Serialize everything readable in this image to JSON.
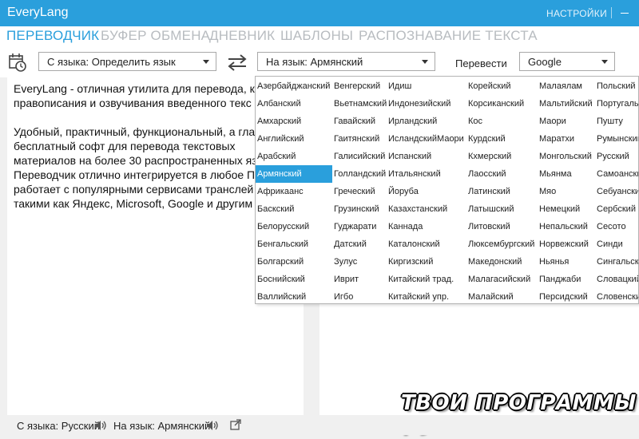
{
  "app": {
    "title": "EveryLang",
    "settings_label": "НАСТРОЙКИ"
  },
  "tabs": [
    {
      "label": "ПЕРЕВОДЧИК",
      "active": true
    },
    {
      "label": "БУФЕР ОБМЕНА",
      "active": false
    },
    {
      "label": "ДНЕВНИК",
      "active": false
    },
    {
      "label": "ШАБЛОНЫ",
      "active": false
    },
    {
      "label": "РАСПОЗНАВАНИЕ ТЕКСТА",
      "active": false
    }
  ],
  "toolbar": {
    "history_icon": "history-calendar-icon",
    "from_select": "С языка: Определить язык",
    "swap_icon": "swap-arrows-icon",
    "to_select": "На язык: Армянский",
    "translate_label": "Перевести",
    "service_select": "Google"
  },
  "source": {
    "paragraph1": "EveryLang - отличная утилита для перевода, к правописания и озвучивания введенного текс",
    "paragraph2": "Удобный, практичный, функциональный, а гла бесплатный софт для перевода текстовых материалов на более 30 распространенных яз Переводчик отлично интегрируется в любое П работает с популярными сервисами транслей такими как Яндекс, Microsoft, Google и другим"
  },
  "status": {
    "from": "С языка: Русский",
    "to": "На язык: Армянский",
    "speaker_icon": "speaker-icon",
    "open_icon": "open-external-icon"
  },
  "watermark": "ТВОИ ПРОГРАММЫ РУ",
  "colors": {
    "accent": "#2a9fdc",
    "selected_bg": "#2a9fdc",
    "tab_inactive": "#b8bcc0"
  },
  "languages": {
    "selected": "Армянский",
    "columns": [
      [
        "Азербайджанский",
        "Албанский",
        "Амхарский",
        "Английский",
        "Арабский",
        "Армянский",
        "Африкаанс",
        "Баскский",
        "Белорусский",
        "Бенгальский",
        "Болгарский",
        "Боснийский",
        "Валлийский"
      ],
      [
        "Венгерский",
        "Вьетнамский",
        "Гавайский",
        "Гаитянский",
        "Галисийский",
        "Голландский",
        "Греческий",
        "Грузинский",
        "Гуджарати",
        "Датский",
        "Зулус",
        "Иврит",
        "Игбо"
      ],
      [
        "Идиш",
        "Индонезийский",
        "Ирландский",
        "ИсландскийМаори",
        "Испанский",
        "Итальянский",
        "Йоруба",
        "Казахстанский",
        "Каннада",
        "Каталонский",
        "Киргизский",
        "Китайский трад.",
        "Китайский упр."
      ],
      [
        "Корейский",
        "Корсиканский",
        "Кос",
        "Курдский",
        "Кхмерский",
        "Лаосский",
        "Латинский",
        "Латышский",
        "Литовский",
        "Люксембургский",
        "Македонский",
        "Малагасийский",
        "Малайский"
      ],
      [
        "Малаялам",
        "Мальтийский",
        "Маори",
        "Маратхи",
        "Монгольский",
        "Мьянма",
        "Мяо",
        "Немецкий",
        "Непальский",
        "Норвежский",
        "Ньянья",
        "Панджаби",
        "Персидский"
      ],
      [
        "Польский",
        "Португальский",
        "Пушту",
        "Румынский",
        "Русский",
        "Самоанский",
        "Себуанский",
        "Сербский",
        "Сесото",
        "Синди",
        "Сингальский",
        "Словацкий",
        "Словенский"
      ]
    ]
  }
}
